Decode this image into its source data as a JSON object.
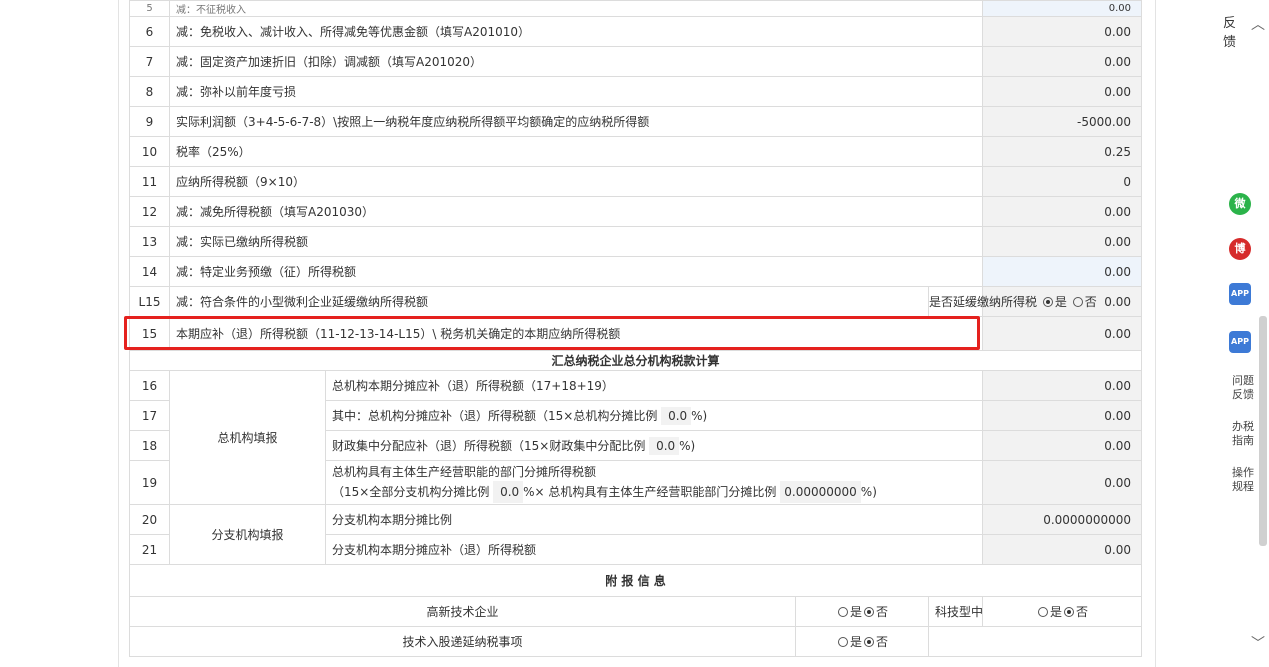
{
  "top_row": {
    "num": "5",
    "label": "减：不征税收入",
    "value": "0.00"
  },
  "rows": [
    {
      "num": "6",
      "label": "减：免税收入、减计收入、所得减免等优惠金额（填写A201010）",
      "value": "0.00"
    },
    {
      "num": "7",
      "label": "减：固定资产加速折旧（扣除）调减额（填写A201020）",
      "value": "0.00"
    },
    {
      "num": "8",
      "label": "减：弥补以前年度亏损",
      "value": "0.00"
    },
    {
      "num": "9",
      "label": "实际利润额（3+4-5-6-7-8）\\按照上一纳税年度应纳税所得额平均额确定的应纳税所得额",
      "value": "-5000.00"
    },
    {
      "num": "10",
      "label": "税率（25%）",
      "value": "0.25"
    },
    {
      "num": "11",
      "label": "应纳所得税额（9×10）",
      "value": "0"
    },
    {
      "num": "12",
      "label": "减：减免所得税额（填写A201030）",
      "value": "0.00"
    },
    {
      "num": "13",
      "label": "减：实际已缴纳所得税额",
      "value": "0.00"
    },
    {
      "num": "14",
      "label": "减：特定业务预缴（征）所得税额",
      "value": "0.00"
    }
  ],
  "row_l15": {
    "num": "L15",
    "label": "减：符合条件的小型微利企业延缓缴纳所得税额",
    "defer_question": "是否延缓缴纳所得税",
    "yes": "是",
    "no": "否",
    "value": "0.00"
  },
  "row_15": {
    "num": "15",
    "label": "本期应补（退）所得税额（11-12-13-14-L15）\\ 税务机关确定的本期应纳所得税额",
    "value": "0.00"
  },
  "section_summary": {
    "title": "汇总纳税企业总分机构税款计算",
    "head_office_label": "总机构填报",
    "branch_label": "分支机构填报",
    "r16": {
      "num": "16",
      "label": "总机构本期分摊应补（退）所得税额（17+18+19）",
      "value": "0.00"
    },
    "r17": {
      "num": "17",
      "label_pre": "其中：总机构分摊应补（退）所得税额（15×总机构分摊比例",
      "ratio": "0.0",
      "label_post": "%)",
      "value": "0.00"
    },
    "r18": {
      "num": "18",
      "label_pre": "财政集中分配应补（退）所得税额（15×财政集中分配比例",
      "ratio": "0.0",
      "label_post": "%)",
      "value": "0.00"
    },
    "r19": {
      "num": "19",
      "line1": "总机构具有主体生产经营职能的部门分摊所得税额",
      "line2_pre": "（15×全部分支机构分摊比例",
      "ratio1": "0.0",
      "line2_mid": "%× 总机构具有主体生产经营职能部门分摊比例",
      "ratio2": "0.00000000",
      "line2_post": "%)",
      "value": "0.00"
    },
    "r20": {
      "num": "20",
      "label": "分支机构本期分摊比例",
      "value": "0.0000000000"
    },
    "r21": {
      "num": "21",
      "label": "分支机构本期分摊应补（退）所得税额",
      "value": "0.00"
    }
  },
  "section_extra": {
    "title": "附 报 信 息",
    "hi_tech_label": "高新技术企业",
    "sme_tech_label": "科技型中小企业",
    "tech_invest_label": "技术入股递延纳税事项",
    "yes": "是",
    "no": "否"
  },
  "sidebar": {
    "feedback": "反馈",
    "wechat_glyph": "微",
    "weibo_glyph": "博",
    "app_glyph": "APP",
    "problem_feedback": "问题反馈",
    "tax_guide": "办税指南",
    "operation_rules": "操作规程"
  }
}
